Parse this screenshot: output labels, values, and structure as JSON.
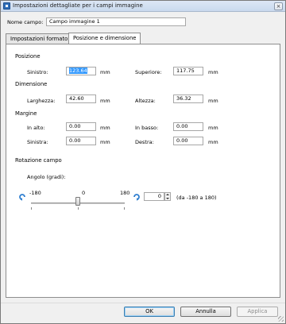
{
  "window": {
    "title": "Impostazioni dettagliate per i campi immagine",
    "close_label": "×"
  },
  "field_name": {
    "label": "Nome campo:",
    "value": "Campo immagine 1"
  },
  "tabs": [
    {
      "label": "Impostazioni formato",
      "active": false
    },
    {
      "label": "Posizione e dimensione",
      "active": true
    }
  ],
  "position": {
    "heading": "Posizione",
    "left_label": "Sinistro:",
    "left_value": "123.64",
    "left_unit": "mm",
    "top_label": "Superiore:",
    "top_value": "117.75",
    "top_unit": "mm"
  },
  "dimension": {
    "heading": "Dimensione",
    "width_label": "Larghezza:",
    "width_value": "42.60",
    "width_unit": "mm",
    "height_label": "Altezza:",
    "height_value": "36.32",
    "height_unit": "mm"
  },
  "margin": {
    "heading": "Margine",
    "top_label": "In alto:",
    "top_value": "0.00",
    "top_unit": "mm",
    "bottom_label": "In basso:",
    "bottom_value": "0.00",
    "bottom_unit": "mm",
    "left_label": "Sinistra:",
    "left_value": "0.00",
    "left_unit": "mm",
    "right_label": "Destra:",
    "right_value": "0.00",
    "right_unit": "mm"
  },
  "rotation": {
    "heading": "Rotazione campo",
    "angle_label": "Angolo (gradi):",
    "min_label": "-180",
    "mid_label": "0",
    "max_label": "180",
    "slider_fraction": 0.5,
    "value": "0",
    "range_hint": "(da -180 a 180)"
  },
  "buttons": {
    "ok": "OK",
    "cancel": "Annulla",
    "apply": "Applica"
  },
  "colors": {
    "rotate_icon": "#2f7fd0",
    "selection": "#3399ff"
  },
  "icons": {
    "rotate_left": "rotate-left-icon",
    "rotate_right": "rotate-right-icon"
  }
}
